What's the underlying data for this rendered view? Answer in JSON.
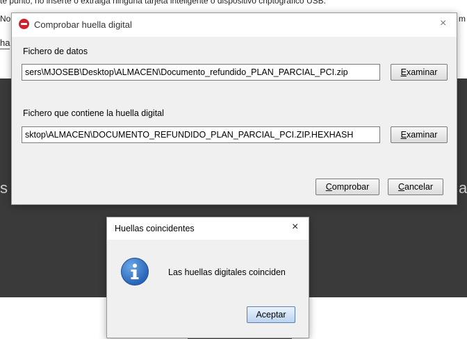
{
  "background": {
    "top_text": "te punto, no inserte o extraiga ninguna tarjeta inteligente o dispositivo criptográfico USB.",
    "line2_text": "No                                                                                                                                                                        ",
    "left_fragment": "ha",
    "right_fragment": "m",
    "dark_left_char": "s",
    "dark_right_char": "a"
  },
  "dialog": {
    "title": "Comprobar huella digital",
    "close_glyph": "×",
    "data_file_label": "Fichero de datos",
    "data_file_value": "sers\\MJOSEB\\Desktop\\ALMACEN\\Documento_refundido_PLAN_PARCIAL_PCI.zip",
    "browse1": {
      "mnemonic": "E",
      "rest": "xaminar"
    },
    "hash_file_label": "Fichero que contiene la huella digital",
    "hash_file_value": "sktop\\ALMACEN\\DOCUMENTO_REFUNDIDO_PLAN_PARCIAL_PCI.ZIP.HEXHASH",
    "browse2": {
      "mnemonic": "E",
      "rest": "xaminar"
    },
    "check": {
      "mnemonic": "C",
      "rest": "omprobar"
    },
    "cancel": {
      "mnemonic": "C",
      "rest": "ancelar"
    }
  },
  "popup": {
    "title": "Huellas coincidentes",
    "close_glyph": "×",
    "message": "Las huellas digitales coinciden",
    "ok_label": "Aceptar"
  }
}
